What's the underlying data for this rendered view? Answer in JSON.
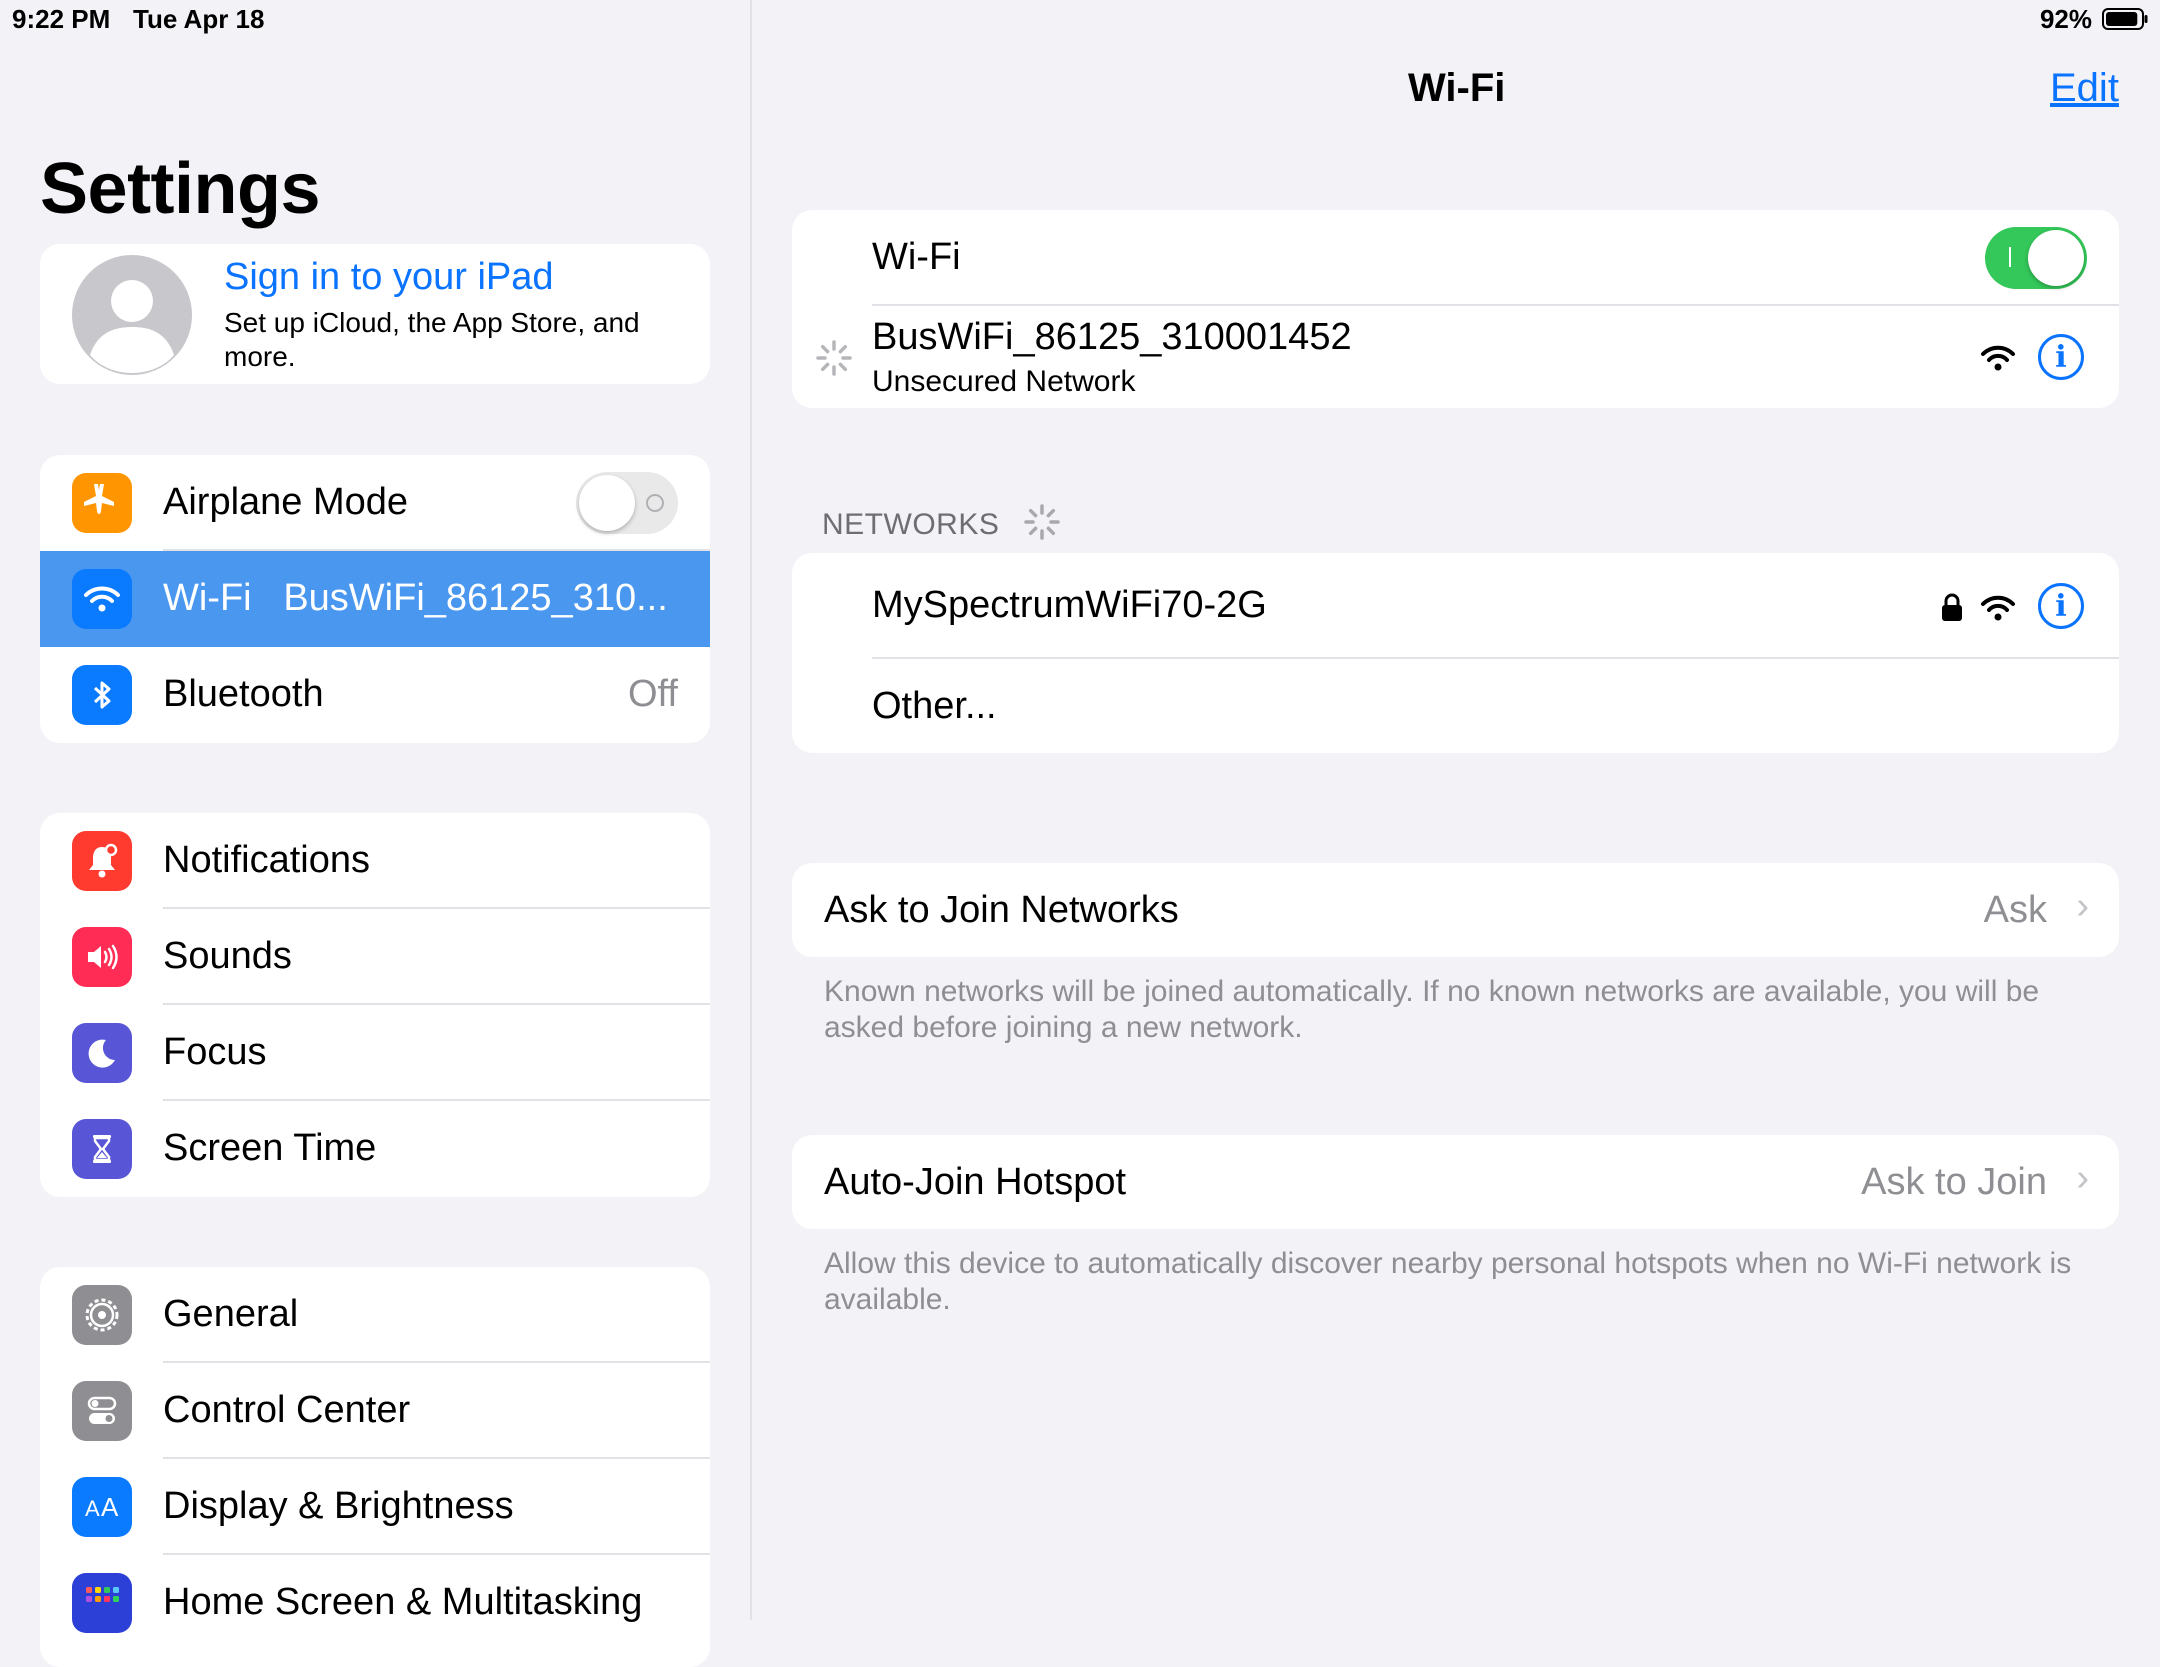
{
  "status_bar": {
    "time": "9:22 PM",
    "date": "Tue Apr 18",
    "battery": "92%",
    "battery_level": 0.92
  },
  "sidebar": {
    "title": "Settings",
    "profile": {
      "title": "Sign in to your iPad",
      "subtitle": "Set up iCloud, the App Store, and more."
    },
    "connectivity": [
      {
        "label": "Airplane Mode",
        "icon": "airplane-icon",
        "color": "#ff9500",
        "toggle": false
      },
      {
        "label": "Wi-Fi",
        "value": "BusWiFi_86125_310...",
        "icon": "wifi-icon",
        "color": "#0a7aff",
        "selected": true
      },
      {
        "label": "Bluetooth",
        "value": "Off",
        "icon": "bluetooth-icon",
        "color": "#0a7aff"
      }
    ],
    "alerts": [
      {
        "label": "Notifications",
        "icon": "bell-icon",
        "color": "#ff3b30"
      },
      {
        "label": "Sounds",
        "icon": "speaker-icon",
        "color": "#ff2d55"
      },
      {
        "label": "Focus",
        "icon": "moon-icon",
        "color": "#5856d6"
      },
      {
        "label": "Screen Time",
        "icon": "hourglass-icon",
        "color": "#5856d6"
      }
    ],
    "system": [
      {
        "label": "General",
        "icon": "gear-icon",
        "color": "#8e8e93"
      },
      {
        "label": "Control Center",
        "icon": "switches-icon",
        "color": "#8e8e93"
      },
      {
        "label": "Display & Brightness",
        "icon": "text-size-icon",
        "color": "#0a7aff"
      },
      {
        "label": "Home Screen & Multitasking",
        "icon": "app-grid-icon",
        "color": "#2c3fd6"
      }
    ]
  },
  "detail": {
    "nav_title": "Wi-Fi",
    "edit": "Edit",
    "wifi_toggle": {
      "label": "Wi-Fi",
      "on": true
    },
    "current_network": {
      "name": "BusWiFi_86125_310001452",
      "subtitle": "Unsecured Network"
    },
    "networks_header": "NETWORKS",
    "networks": [
      {
        "name": "MySpectrumWiFi70-2G",
        "secured": true
      },
      {
        "name": "Other..."
      }
    ],
    "ask_to_join": {
      "label": "Ask to Join Networks",
      "value": "Ask",
      "footer": "Known networks will be joined automatically. If no known networks are available, you will be asked before joining a new network."
    },
    "auto_join": {
      "label": "Auto-Join Hotspot",
      "value": "Ask to Join",
      "footer": "Allow this device to automatically discover nearby personal hotspots when no Wi-Fi network is available."
    }
  },
  "colors": {
    "accent": "#0a73ff",
    "toggle_on": "#34c759",
    "selection": "#4a97f0"
  }
}
